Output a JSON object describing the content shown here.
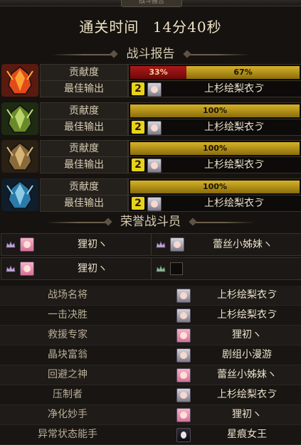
{
  "header": {
    "tab_label": "战斗报告"
  },
  "clear_time": {
    "label": "通关时间",
    "value": "14分40秒"
  },
  "battle_report": {
    "title": "战斗报告",
    "contribution_label": "贡献度",
    "best_output_label": "最佳输出",
    "rows": [
      {
        "icon": "fire-class-icon",
        "segments": [
          {
            "value": "33%",
            "fraction": 0.33,
            "color": "#b01818"
          },
          {
            "value": "67%",
            "fraction": 0.67,
            "color": "#d6b227"
          }
        ],
        "rank": "2",
        "player": "上杉绘梨衣ゔ"
      },
      {
        "icon": "nature-class-icon",
        "segments": [
          {
            "value": "100%",
            "fraction": 1.0,
            "color": "#d6b227"
          }
        ],
        "rank": "2",
        "player": "上杉绘梨衣ゔ"
      },
      {
        "icon": "bronze-class-icon",
        "segments": [
          {
            "value": "100%",
            "fraction": 1.0,
            "color": "#d6b227"
          }
        ],
        "rank": "2",
        "player": "上杉绘梨衣ゔ"
      },
      {
        "icon": "ice-class-icon",
        "segments": [
          {
            "value": "100%",
            "fraction": 1.0,
            "color": "#d6b227"
          }
        ],
        "rank": "2",
        "player": "上杉绘梨衣ゔ"
      }
    ]
  },
  "honor": {
    "title": "荣誉战斗员",
    "members": [
      {
        "name": "狸初ヽ",
        "avatar": "pink"
      },
      {
        "name": "蕾丝小姊妹ヽ",
        "avatar": "gray"
      },
      {
        "name": "狸初ヽ",
        "avatar": "pink"
      },
      {
        "name": "",
        "avatar": "empty"
      }
    ]
  },
  "awards": [
    {
      "title": "战场名将",
      "player": "上杉绘梨衣ゔ",
      "avatar": "gray"
    },
    {
      "title": "一击决胜",
      "player": "上杉绘梨衣ゔ",
      "avatar": "gray"
    },
    {
      "title": "救援专家",
      "player": "狸初ヽ",
      "avatar": "pink"
    },
    {
      "title": "晶块富翁",
      "player": "剧组小漫游",
      "avatar": "gray"
    },
    {
      "title": "回避之神",
      "player": "蕾丝小姊妹ヽ",
      "avatar": "pink"
    },
    {
      "title": "压制者",
      "player": "上杉绘梨衣ゔ",
      "avatar": "gray"
    },
    {
      "title": "净化妙手",
      "player": "狸初ヽ",
      "avatar": "pink"
    },
    {
      "title": "异常状态能手",
      "player": "星痕女王",
      "avatar": "dark"
    }
  ]
}
